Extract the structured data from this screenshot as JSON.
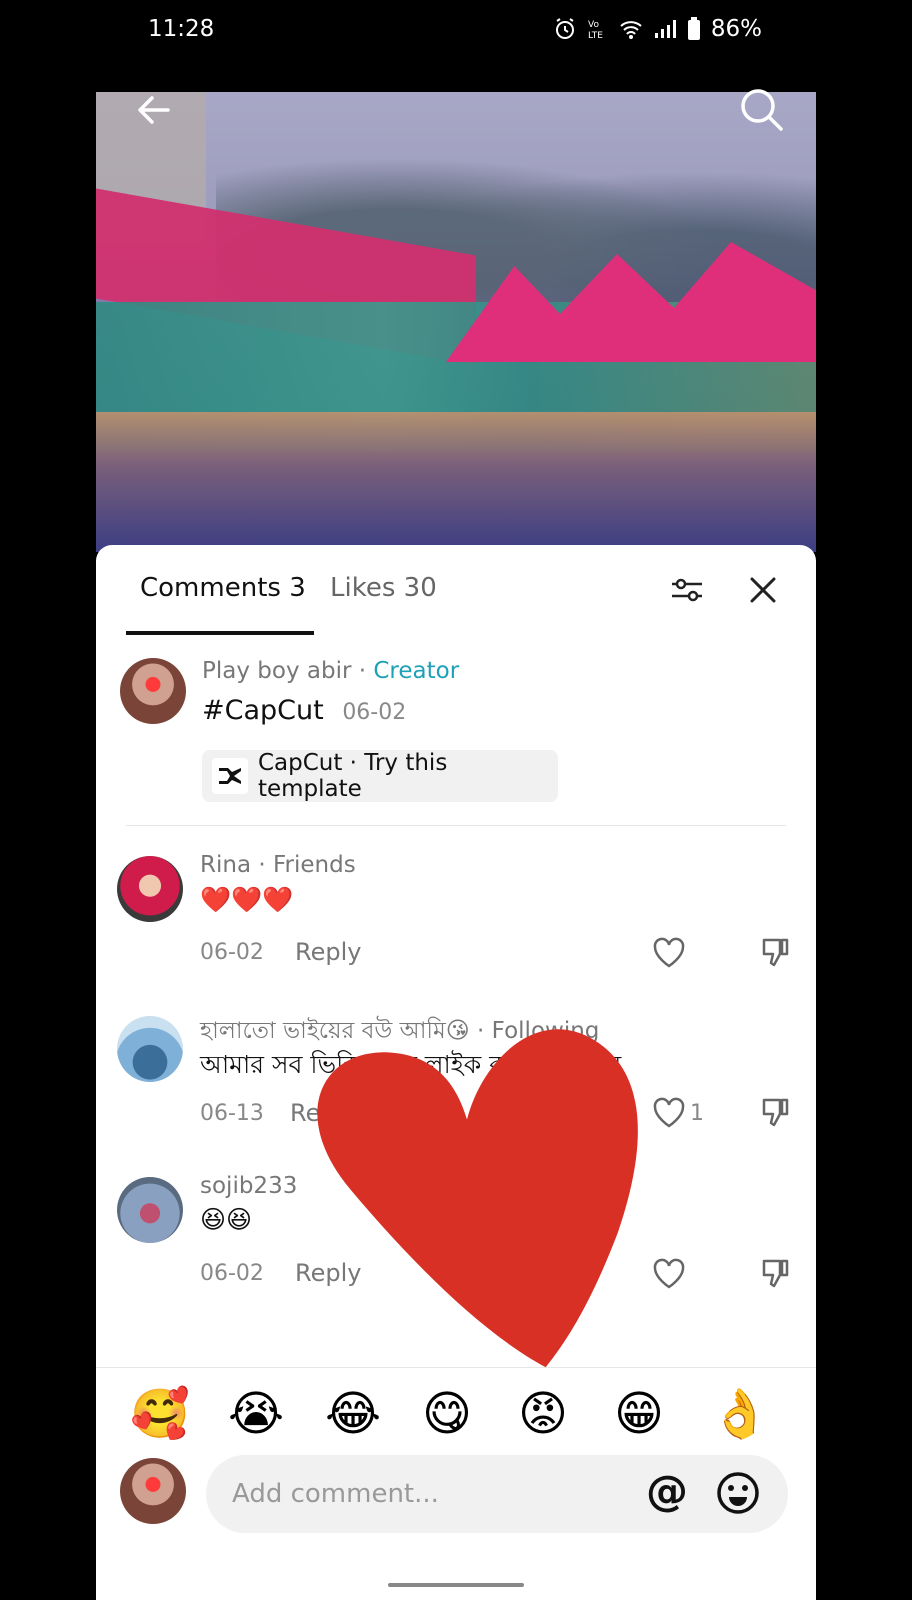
{
  "status": {
    "time": "11:28",
    "battery": "86%",
    "icons": [
      "alarm-icon",
      "volte-icon",
      "wifi-icon",
      "signal-icon",
      "battery-icon"
    ]
  },
  "video": {
    "nav": [
      "back-arrow-icon",
      "search-icon"
    ]
  },
  "tabs": {
    "comments": "Comments 3",
    "likes": "Likes 30"
  },
  "creator_comment": {
    "author": "Play boy abir",
    "sep": " · ",
    "badge": "Creator",
    "text": "#CapCut",
    "date": "06-02",
    "template_label": "CapCut · Try this template"
  },
  "comments": [
    {
      "author": "Rina",
      "relation": " · Friends",
      "text": "❤️❤️❤️",
      "date": "06-02",
      "reply": "Reply",
      "likes": ""
    },
    {
      "author": "হালাতো ভাইয়ের বউ আমি😘",
      "relation": " · Following",
      "text": "আমার সব ভিডিও তে লাইক কমেন্ট পাবেন",
      "date": "06-13",
      "reply": "Reply",
      "likes": "1"
    },
    {
      "author": "sojib233",
      "relation": "",
      "text": "😆😆",
      "date": "06-02",
      "reply": "Reply",
      "likes": ""
    }
  ],
  "emoji_bar": [
    "🥰",
    "😭",
    "😂",
    "😋",
    "😡",
    "😁",
    "👌"
  ],
  "input": {
    "placeholder": "Add comment...",
    "mention": "@"
  },
  "colors": {
    "accent": "#1ea0b8",
    "heart": "#d93026"
  }
}
